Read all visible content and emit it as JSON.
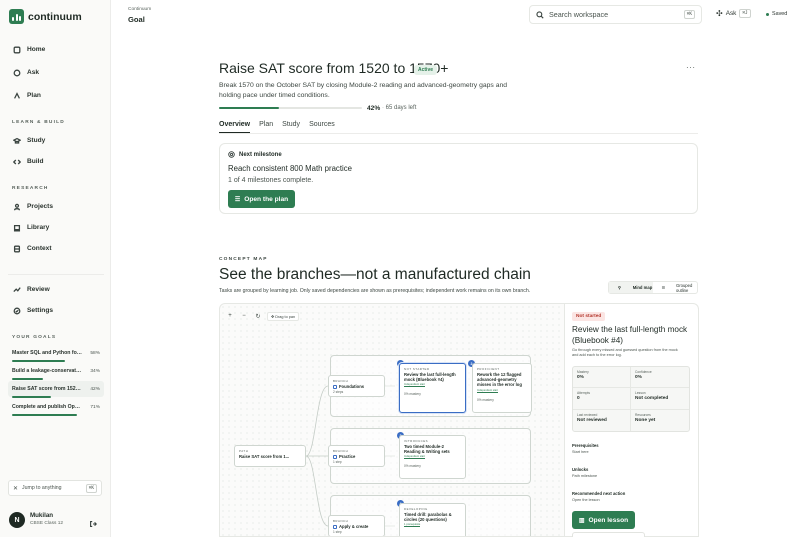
{
  "app": {
    "name": "continuum"
  },
  "sidebar": {
    "nav_main": [
      {
        "label": "Home",
        "icon": "home-icon"
      },
      {
        "label": "Ask",
        "icon": "chat-icon"
      },
      {
        "label": "Plan",
        "icon": "plan-icon"
      }
    ],
    "learn_build_label": "LEARN & BUILD",
    "nav_learn": [
      {
        "label": "Study",
        "icon": "study-icon"
      },
      {
        "label": "Build",
        "icon": "code-icon"
      }
    ],
    "research_label": "RESEARCH",
    "nav_research": [
      {
        "label": "Projects",
        "icon": "person-icon"
      },
      {
        "label": "Library",
        "icon": "book-icon"
      },
      {
        "label": "Context",
        "icon": "database-icon"
      }
    ],
    "nav_other": [
      {
        "label": "Review",
        "icon": "review-icon"
      },
      {
        "label": "Settings",
        "icon": "settings-icon"
      }
    ],
    "goals_label": "YOUR GOALS",
    "goals": [
      {
        "name": "Master SQL and Python for...",
        "pct": "58%",
        "progress": 0.58
      },
      {
        "name": "Build a leakage-conservative...",
        "pct": "34%",
        "progress": 0.34
      },
      {
        "name": "Raise SAT score from 1520 to...",
        "pct": "42%",
        "progress": 0.42
      },
      {
        "name": "Complete and publish Open...",
        "pct": "71%",
        "progress": 0.71
      }
    ],
    "jump_label": "Jump to anything",
    "jump_kbd": "⌘K",
    "user": {
      "initial": "N",
      "name": "Mukilan",
      "subtitle": "CBSE Class 12"
    }
  },
  "header": {
    "breadcrumb": "Continuum",
    "title": "Goal",
    "search_placeholder": "Search workspace",
    "search_kbd": "⌘K",
    "ask_label": "Ask",
    "ask_kbd": "⌘J",
    "saved_label": "Saved"
  },
  "goal": {
    "title": "Raise SAT score from 1520 to 1570+",
    "status": "Active",
    "description": "Break 1570 on the October SAT by closing Module-2 reading and advanced-geometry gaps and holding pace under timed conditions.",
    "progress_label": "42%",
    "progress": 0.42,
    "days_left": "65 days left",
    "more": "···",
    "tabs": [
      "Overview",
      "Plan",
      "Study",
      "Sources"
    ]
  },
  "milestone": {
    "label": "Next milestone",
    "title": "Reach consistent 800 Math practice",
    "subtitle": "1 of 4 milestones complete.",
    "button": "Open the plan"
  },
  "concept_map": {
    "label": "CONCEPT MAP",
    "title": "See the branches—not a manufactured chain",
    "description": "Tasks are grouped by learning job. Only saved dependencies are shown as prerequisites; independent work remains on its own branch.",
    "views": [
      "Mind map",
      "Grouped outline"
    ],
    "tools": {
      "zoom_in": "+",
      "zoom_out": "−",
      "reset": "↻",
      "drag": "Drag to pan"
    },
    "path_node": {
      "kicker": "PATH",
      "title": "Raise SAT score from 1..."
    },
    "branches": [
      {
        "kicker": "BRANCH",
        "title": "Foundations",
        "sub": "2 steps"
      },
      {
        "kicker": "BRANCH",
        "title": "Practice",
        "sub": "1 step"
      },
      {
        "kicker": "BRANCH",
        "title": "Apply & create",
        "sub": "1 step"
      }
    ],
    "tasks": [
      {
        "num": "1",
        "status": "NOT STARTED",
        "title": "Review the last full-length mock (Bluebook #4)",
        "tag": "Independent start",
        "mastery": "0% mastery"
      },
      {
        "num": "2",
        "status": "PROFICIENT",
        "title": "Rework the 12 flagged advanced-geometry misses in the error log",
        "tag": "Independent start",
        "mastery": "0% mastery"
      },
      {
        "num": "3",
        "status": "INTRODUCES",
        "title": "Two timed Module-2 Reading & Writing sets",
        "tag": "Independent start",
        "mastery": "0% mastery"
      },
      {
        "num": "4",
        "status": "DEVELOPING",
        "title": "Timed drill: parabolas & circles (20 questions)",
        "tag": "1 prerequisite"
      }
    ]
  },
  "detail": {
    "status": "Not started",
    "title": "Review the last full-length mock (Bluebook #4)",
    "description": "Go through every missed and guessed question from the mock and add each to the error log.",
    "stats": [
      {
        "label": "Mastery",
        "value": "0%"
      },
      {
        "label": "Confidence",
        "value": "0%"
      },
      {
        "label": "Attempts",
        "value": "0"
      },
      {
        "label": "Lesson",
        "value": "Not completed"
      },
      {
        "label": "Last reviewed",
        "value": "Not reviewed"
      },
      {
        "label": "Resources",
        "value": "None yet"
      }
    ],
    "prereq_label": "Prerequisites",
    "prereq_value": "Start here",
    "unlocks_label": "Unlocks",
    "unlocks_value": "Path milestone",
    "rec_label": "Recommended next action",
    "rec_value": "Open the lesson",
    "button": "Open lesson"
  },
  "colors": {
    "accent": "#2e7d52",
    "selection": "#3a6dc4",
    "danger": "#b4382e"
  }
}
